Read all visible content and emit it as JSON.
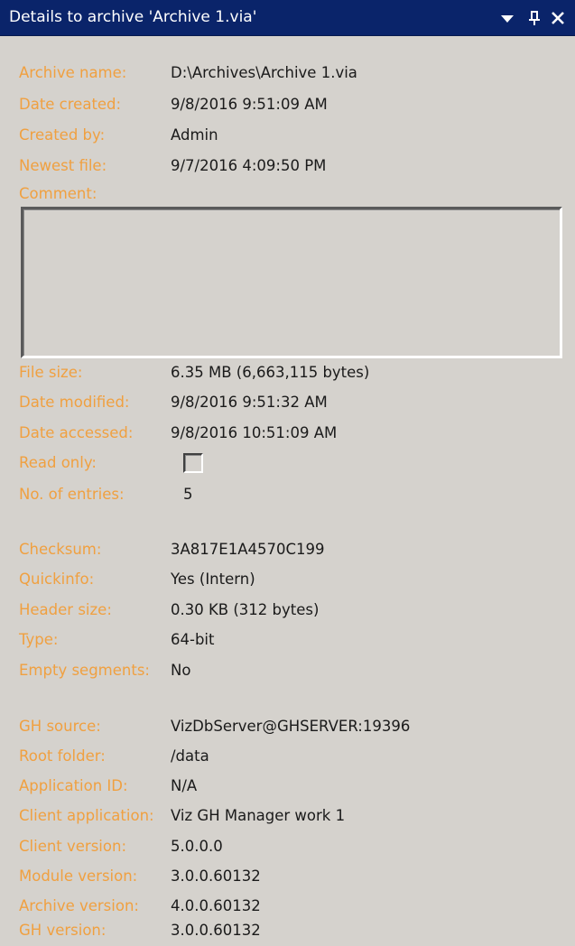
{
  "window": {
    "title": "Details to archive 'Archive 1.via'",
    "icons": {
      "menu": "dropdown-arrow-icon",
      "pin": "pin-icon",
      "close": "close-icon"
    }
  },
  "colors": {
    "label": "#f0a040",
    "value": "#1a1a1a",
    "titlebar": "#0a246a",
    "background": "#d5d2cd"
  },
  "details": {
    "archive_name": {
      "label": "Archive name:",
      "value": "D:\\Archives\\Archive 1.via"
    },
    "date_created": {
      "label": "Date created:",
      "value": "9/8/2016 9:51:09 AM"
    },
    "created_by": {
      "label": "Created by:",
      "value": "Admin"
    },
    "newest_file": {
      "label": "Newest file:",
      "value": "9/7/2016 4:09:50 PM"
    },
    "comment": {
      "label": "Comment:",
      "value": ""
    },
    "file_size": {
      "label": "File size:",
      "value": "6.35 MB (6,663,115 bytes)"
    },
    "date_modified": {
      "label": "Date modified:",
      "value": "9/8/2016 9:51:32 AM"
    },
    "date_accessed": {
      "label": "Date accessed:",
      "value": "9/8/2016 10:51:09 AM"
    },
    "read_only": {
      "label": "Read only:",
      "checked": false
    },
    "entries": {
      "label": "No. of entries:",
      "value": "5"
    }
  },
  "archive_info": {
    "checksum": {
      "label": "Checksum:",
      "value": "3A817E1A4570C199"
    },
    "quickinfo": {
      "label": "Quickinfo:",
      "value": "Yes (Intern)"
    },
    "header_size": {
      "label": "Header size:",
      "value": "0.30 KB (312 bytes)"
    },
    "type": {
      "label": "Type:",
      "value": "64-bit"
    },
    "empty_segments": {
      "label": "Empty segments:",
      "value": "No"
    }
  },
  "source_info": {
    "gh_source": {
      "label": "GH source:",
      "value": "VizDbServer@GHSERVER:19396"
    },
    "root_folder": {
      "label": "Root folder:",
      "value": "/data"
    },
    "application_id": {
      "label": "Application ID:",
      "value": "N/A"
    },
    "client_application": {
      "label": "Client application:",
      "value": "Viz GH Manager work 1"
    },
    "client_version": {
      "label": "Client version:",
      "value": "5.0.0.0"
    },
    "module_version": {
      "label": "Module version:",
      "value": "3.0.0.60132"
    },
    "archive_version": {
      "label": "Archive version:",
      "value": "4.0.0.60132"
    },
    "gh_version": {
      "label": "GH version:",
      "value": "3.0.0.60132"
    }
  }
}
